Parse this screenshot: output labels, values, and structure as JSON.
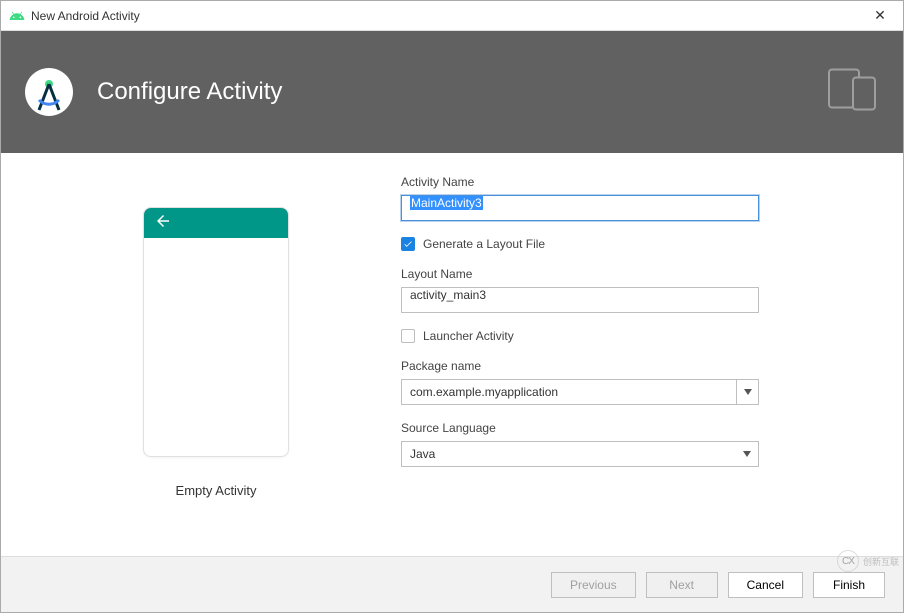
{
  "window": {
    "title": "New Android Activity"
  },
  "banner": {
    "title": "Configure Activity"
  },
  "preview": {
    "label": "Empty Activity"
  },
  "form": {
    "activity_name_label": "Activity Name",
    "activity_name_value": "MainActivity3",
    "generate_layout_label": "Generate a Layout File",
    "generate_layout_checked": true,
    "layout_name_label": "Layout Name",
    "layout_name_value": "activity_main3",
    "launcher_label": "Launcher Activity",
    "launcher_checked": false,
    "package_label": "Package name",
    "package_value": "com.example.myapplication",
    "language_label": "Source Language",
    "language_value": "Java"
  },
  "footer": {
    "previous": "Previous",
    "next": "Next",
    "cancel": "Cancel",
    "finish": "Finish"
  },
  "watermark": "创新互联"
}
